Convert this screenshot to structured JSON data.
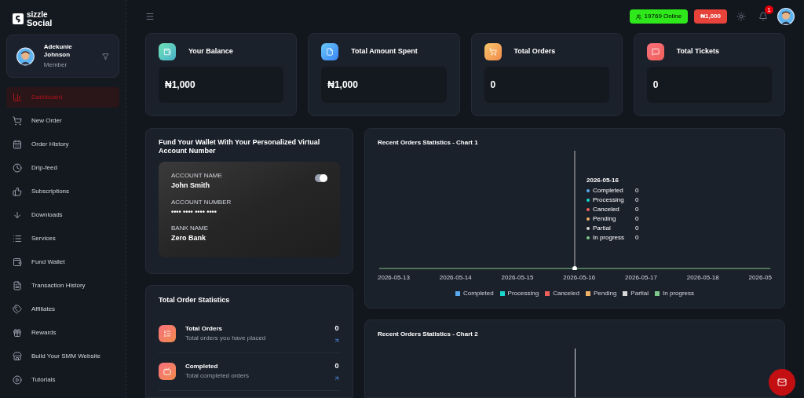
{
  "logo": {
    "line_1": "sizzle",
    "line_2": "Social"
  },
  "user": {
    "name": "Adekunle Johnson",
    "role": "Member"
  },
  "sidebar": {
    "items": [
      {
        "label": "Dashboard",
        "selected": true
      },
      {
        "label": "New Order",
        "selected": false
      },
      {
        "label": "Order History",
        "selected": false
      },
      {
        "label": "Drip-feed",
        "selected": false
      },
      {
        "label": "Subscriptions",
        "selected": false
      },
      {
        "label": "Downloads",
        "selected": false
      },
      {
        "label": "Services",
        "selected": false
      },
      {
        "label": "Fund Wallet",
        "selected": false
      },
      {
        "label": "Transaction History",
        "selected": false
      },
      {
        "label": "Affiliates",
        "selected": false
      },
      {
        "label": "Rewards",
        "selected": false
      },
      {
        "label": "Build Your SMM Website",
        "selected": false
      },
      {
        "label": "Tutorials",
        "selected": false
      }
    ]
  },
  "top_bar": {
    "online": "19769 Online",
    "balance": "₦1,000",
    "notifications": "1"
  },
  "stats": [
    {
      "title": "Your Balance",
      "value": "₦1,000"
    },
    {
      "title": "Total Amount Spent",
      "value": "₦1,000"
    },
    {
      "title": "Total Orders",
      "value": "0"
    },
    {
      "title": "Total Tickets",
      "value": "0"
    }
  ],
  "fund_wallet": {
    "title": "Fund Your Wallet With Your Personalized Virtual Account Number",
    "toggle_on": true,
    "fields": [
      {
        "label": "ACCOUNT NAME",
        "value": "John Smith"
      },
      {
        "label": "ACCOUNT NUMBER",
        "value": "•••• •••• •••• ••••"
      },
      {
        "label": "BANK NAME",
        "value": "Zero Bank"
      }
    ]
  },
  "order_stats": {
    "title": "Total Order Statistics",
    "rows": [
      {
        "title": "Total Orders",
        "subtitle": "Total orders you have placed",
        "value": "0"
      },
      {
        "title": "Completed",
        "subtitle": "Total completed orders",
        "value": "0"
      }
    ]
  },
  "chart_1": {
    "title": "Recent Orders Statistics - Chart 1",
    "x_labels": [
      "2026-05-13",
      "2026-05-14",
      "2026-05-15",
      "2026-05-16",
      "2026-05-17",
      "2026-05-18",
      "2026-05"
    ],
    "tooltip": {
      "date": "2026-05-16",
      "rows": [
        {
          "name": "Completed",
          "value": "0",
          "color": "#5aa9f0"
        },
        {
          "name": "Processing",
          "value": "0",
          "color": "#19d8d0"
        },
        {
          "name": "Canceled",
          "value": "0",
          "color": "#f0605a"
        },
        {
          "name": "Pending",
          "value": "0",
          "color": "#f2b266"
        },
        {
          "name": "Partial",
          "value": "0",
          "color": "#d8d8d8"
        },
        {
          "name": "In progress",
          "value": "0",
          "color": "#7fc98a"
        }
      ]
    },
    "legend": [
      {
        "name": "Completed",
        "color": "#5aa9f0"
      },
      {
        "name": "Processing",
        "color": "#19d8d0"
      },
      {
        "name": "Canceled",
        "color": "#f0605a"
      },
      {
        "name": "Pending",
        "color": "#f2b266"
      },
      {
        "name": "Partial",
        "color": "#d8d8d8"
      },
      {
        "name": "In progress",
        "color": "#7fc98a"
      }
    ]
  },
  "chart_2": {
    "title": "Recent Orders Statistics - Chart 2"
  }
}
